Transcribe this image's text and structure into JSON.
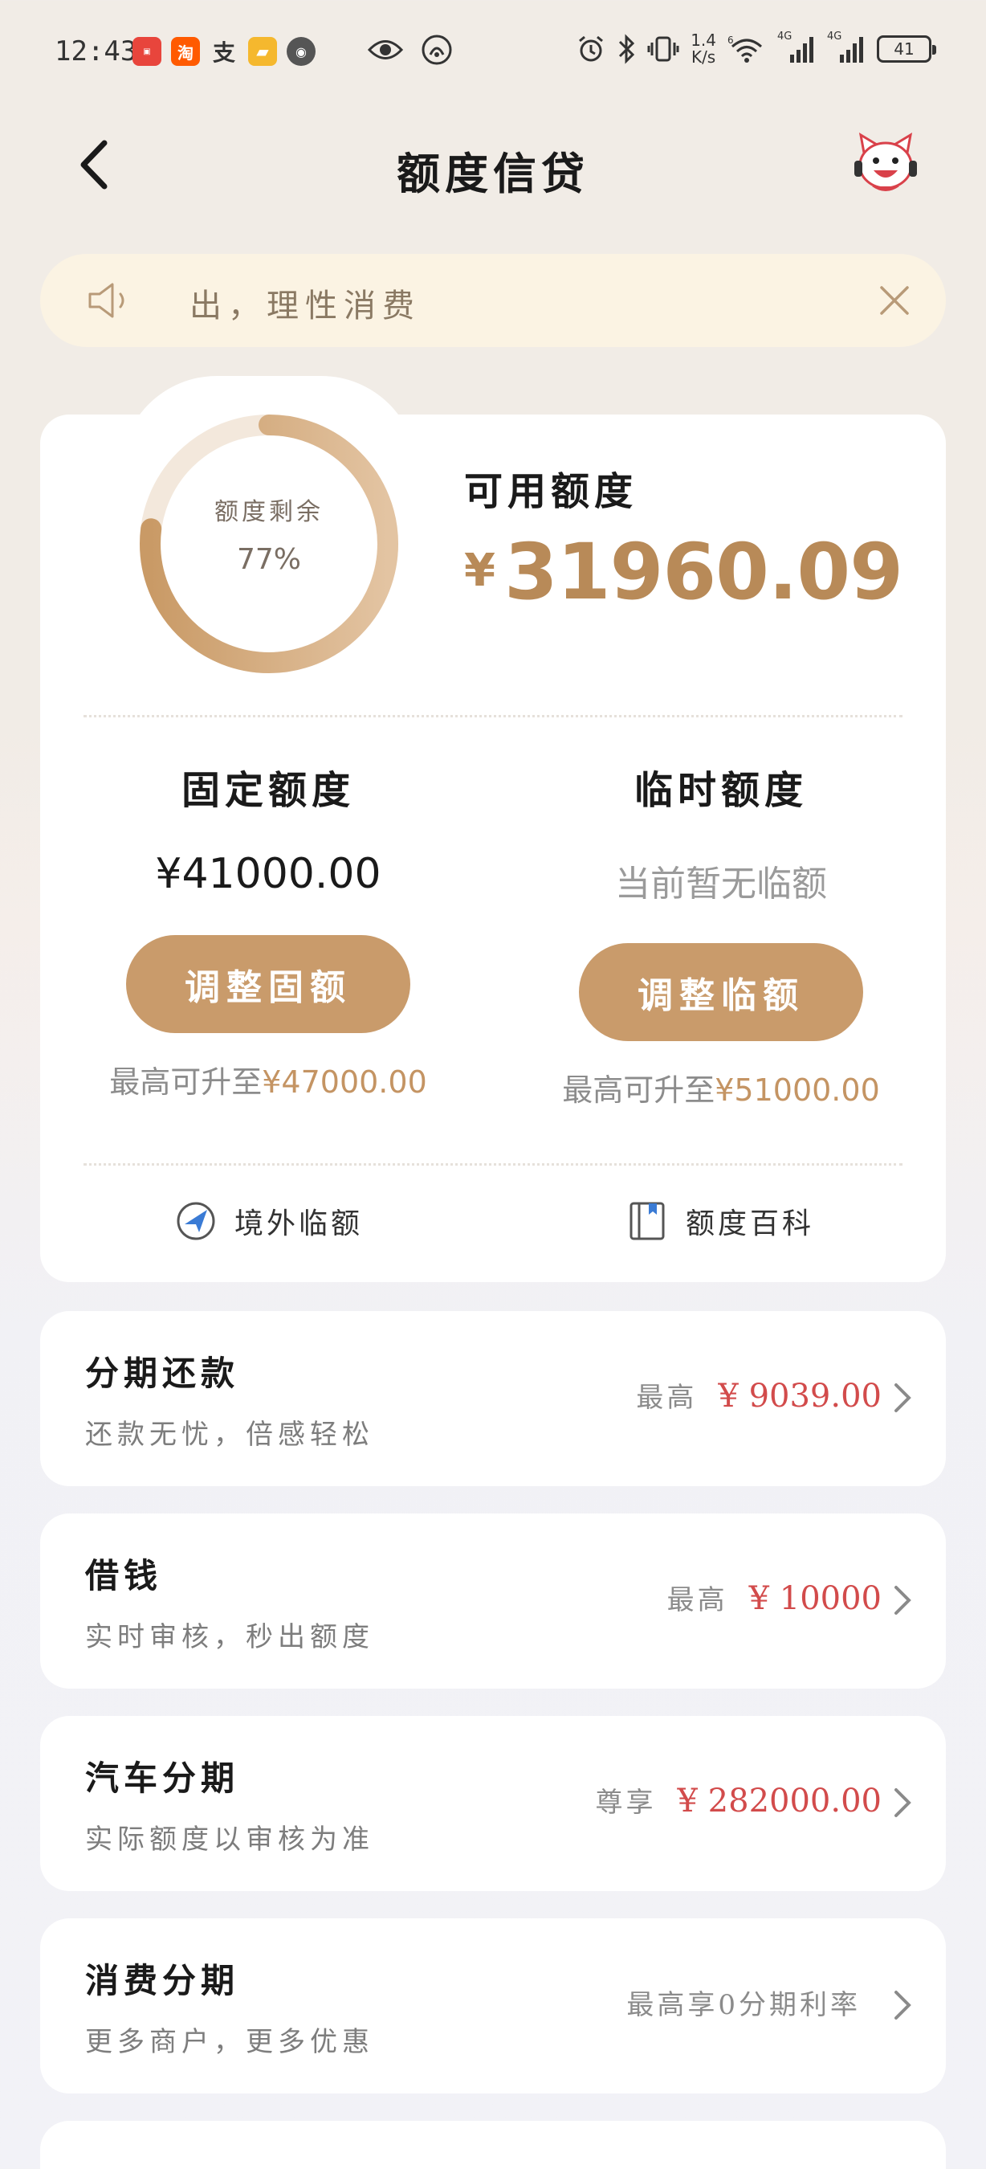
{
  "status_bar": {
    "time": "12:43",
    "net_speed": "1.4",
    "net_unit": "K/s",
    "signal1": "4G",
    "signal2": "4G",
    "battery": "41",
    "wifi_badge": "6"
  },
  "header": {
    "title": "额度信贷"
  },
  "notice": {
    "text": "出，理性消费"
  },
  "credit": {
    "ring_label": "额度剩余",
    "ring_percent": "77%",
    "ring_fraction": 0.77,
    "available_label": "可用额度",
    "currency": "¥",
    "available_amount": "31960.09",
    "fixed": {
      "title": "固定额度",
      "amount": "¥41000.00",
      "button": "调整固额",
      "max_prefix": "最高可升至",
      "max_value": "¥47000.00"
    },
    "temporary": {
      "title": "临时额度",
      "status": "当前暂无临额",
      "button": "调整临额",
      "max_prefix": "最高可升至",
      "max_value": "¥51000.00"
    },
    "tools": {
      "overseas": "境外临额",
      "wiki": "额度百科"
    }
  },
  "products": [
    {
      "title": "分期还款",
      "subtitle": "还款无忧，倍感轻松",
      "prefix": "最高",
      "amount": "¥ 9039.00"
    },
    {
      "title": "借钱",
      "subtitle": "实时审核，秒出额度",
      "prefix": "最高",
      "amount": "¥ 10000"
    },
    {
      "title": "汽车分期",
      "subtitle": "实际额度以审核为准",
      "prefix": "尊享",
      "amount": "¥ 282000.00"
    },
    {
      "title": "消费分期",
      "subtitle": "更多商户，更多优惠",
      "prefix": "最高享0分期利率",
      "amount": ""
    }
  ],
  "colors": {
    "accent": "#c99b6b",
    "amount_gold": "#b88a58",
    "price_red": "#d24b4b"
  }
}
